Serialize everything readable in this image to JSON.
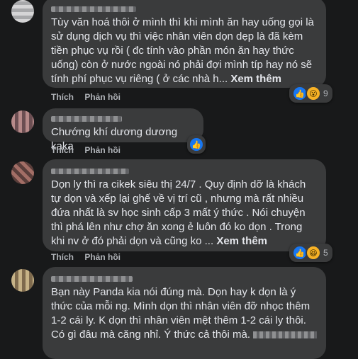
{
  "comments": [
    {
      "text": "Tùy văn hoá thôi ở mình thì khi mình ăn hay uống gọi là sử dụng dịch vụ thì việc nhân viên dọn dẹp là đã kèm tiền phục vụ rồi ( đc tính vào phần món ăn hay thức uống) còn ở nước ngoài nó phải đợi mình típ hay nó sẽ tính phí phục vụ riêng ( ở các nhà h...",
      "more": "Xem thêm",
      "like": "Thích",
      "reply": "Phản hồi",
      "reactions": [
        "like-icon",
        "wow-icon"
      ],
      "reaction_count": "9"
    },
    {
      "text": "Chướng khí dương dương kaka",
      "more": "",
      "like": "Thích",
      "reply": "Phản hồi",
      "reactions": [
        "like-icon"
      ],
      "reaction_count": ""
    },
    {
      "text": "Dọn ly thì ra cikek siêu thị 24/7 . Quy định dỡ là khách tự dọn và xếp lại ghế về vị trí cũ , nhưng mà rất nhiều đứa nhất là sv học sinh cấp 3 mất ý thức . Nói chuyện thì phá lên như chợ ăn xong ẻ luôn đó ko dọn . Trong khi nv ở đó phải dọn và cũng ko ...",
      "more": "Xem thêm",
      "like": "Thích",
      "reply": "Phản hồi",
      "reactions": [
        "like-icon",
        "haha-icon"
      ],
      "reaction_count": "5"
    },
    {
      "text": "Bạn này Panda kia nói đúng mà. Dọn hay k dọn là ý thức của mỗi ng. Mình dọn thì nhân viên đỡ nhọc thêm 1-2 cái ly. K dọn thì nhân viên mệt thêm 1-2 cái ly thôi. Có gì đâu mà căng nhỉ. Ý thức cả thôi mà.",
      "more": "",
      "like": "",
      "reply": "",
      "reactions": [],
      "reaction_count": ""
    }
  ],
  "colors": {
    "background": "#18191a",
    "bubble": "#3a3b3c",
    "text": "#e4e6eb",
    "muted": "#b0b3b8",
    "like": "#1877f2",
    "emoji": "#f7b125"
  }
}
